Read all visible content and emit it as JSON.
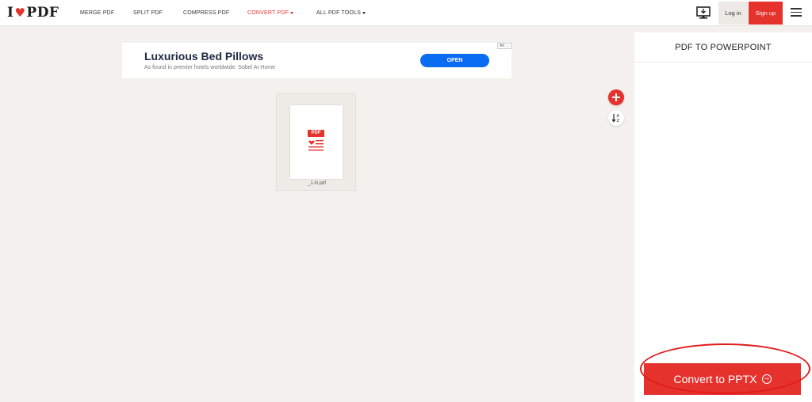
{
  "brand": {
    "prefix": "I",
    "heart": "♥",
    "name": "PDF"
  },
  "nav": {
    "merge": "MERGE PDF",
    "split": "SPLIT PDF",
    "compress": "COMPRESS PDF",
    "convert": "CONVERT PDF",
    "all_tools": "ALL PDF TOOLS"
  },
  "header": {
    "login": "Log in",
    "signup": "Sign up"
  },
  "ad": {
    "title": "Luxurious Bed Pillows",
    "subtitle": "As found in premier hotels worldwide. Sobel At Home",
    "cta": "OPEN",
    "badge": "Ad"
  },
  "file": {
    "badge": "PDF",
    "name": "_1-N.pdf"
  },
  "panel": {
    "title": "PDF TO POWERPOINT",
    "convert": "Convert to PPTX",
    "convert_icon": "⇾"
  },
  "colors": {
    "accent": "#e5322d",
    "ad_button": "#0a6cf3",
    "background": "#f3f0ed"
  },
  "icons": [
    "desktop-icon",
    "menu-icon",
    "plus-icon",
    "sort-icon",
    "arrow-circle-icon"
  ]
}
